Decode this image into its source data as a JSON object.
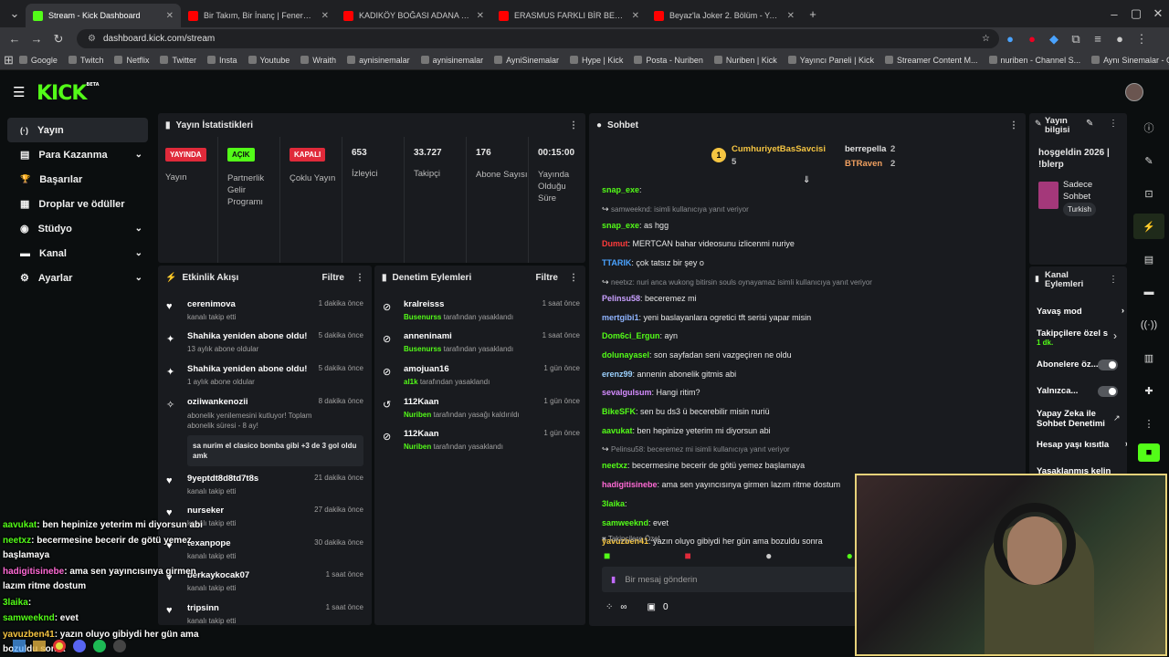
{
  "browser": {
    "tabs": [
      {
        "title": "Stream - Kick Dashboard",
        "fav": "#53fc18",
        "active": true
      },
      {
        "title": "Bir Takım, Bir İnanç | Fenerbahçe",
        "fav": "#ff0000"
      },
      {
        "title": "KADIKÖY BOĞASI ADANA YÜRÜ",
        "fav": "#ff0000"
      },
      {
        "title": "ERASMUS FARKLI BİR BEDENDE",
        "fav": "#ff0000"
      },
      {
        "title": "Beyaz'la Joker 2. Bölüm - YouTu",
        "fav": "#ff0000"
      }
    ],
    "url": "dashboard.kick.com/stream",
    "bookmarks": [
      "Google",
      "Twitch",
      "Netflix",
      "Twitter",
      "Insta",
      "Youtube",
      "Wraith",
      "aynisinemalar",
      "aynisinemalar",
      "AyniSinemalar",
      "Hype | Kick",
      "Posta - Nuriben",
      "Nuriben | Kick",
      "Yayıncı Paneli | Kick",
      "Streamer Content M...",
      "nuriben - Channel S...",
      "Aynı Sinemalar - Ça..."
    ]
  },
  "logo": "KICK",
  "logo_beta": "BETA",
  "sidebar": {
    "items": [
      {
        "icon": "(·)",
        "label": "Yayın",
        "chev": ""
      },
      {
        "icon": "▤",
        "label": "Para Kazanma",
        "chev": "⌄"
      },
      {
        "icon": "🏆",
        "label": "Başarılar",
        "chev": ""
      },
      {
        "icon": "▦",
        "label": "Droplar ve ödüller",
        "chev": ""
      },
      {
        "icon": "◉",
        "label": "Stüdyo",
        "chev": "⌄"
      },
      {
        "icon": "▬",
        "label": "Kanal",
        "chev": "⌄"
      },
      {
        "icon": "⚙",
        "label": "Ayarlar",
        "chev": "⌄"
      }
    ]
  },
  "stats": {
    "title": "Yayın İstatistikleri",
    "b1": "YAYINDA",
    "b1_label": "Yayın",
    "b2": "AÇIK",
    "b2_label": "Partnerlik Gelir Programı",
    "b3": "KAPALI",
    "b3_label": "Çoklu Yayın",
    "viewers": "653",
    "viewers_label": "İzleyici",
    "followers": "33.727",
    "followers_label": "Takipçi",
    "subs": "176",
    "subs_label": "Abone Sayısı",
    "duration": "00:15:00",
    "duration_label": "Yayında Olduğu Süre"
  },
  "activity": {
    "title": "Etkinlik Akışı",
    "filter": "Filtre",
    "items": [
      {
        "name": "cerenimova",
        "sub": "kanalı takip etti",
        "time": "1 dakika önce"
      },
      {
        "name": "Shahika yeniden abone oldu!",
        "sub": "13 aylık abone oldular",
        "time": "5 dakika önce"
      },
      {
        "name": "Shahika yeniden abone oldu!",
        "sub": "1 aylık abone oldular",
        "time": "5 dakika önce"
      },
      {
        "name": "oziiwankenozii",
        "sub": "abonelik yenilemesini kutluyor! Toplam abonelik süresi - 8 ay!",
        "time": "8 dakika önce",
        "msg": "sa nurim el clasico bomba gibi +3 de 3 gol oldu amk"
      },
      {
        "name": "9yeptdt8d8td7t8s",
        "sub": "kanalı takip etti",
        "time": "21 dakika önce"
      },
      {
        "name": "nurseker",
        "sub": "kanalı takip etti",
        "time": "27 dakika önce"
      },
      {
        "name": "texanpope",
        "sub": "kanalı takip etti",
        "time": "30 dakika önce"
      },
      {
        "name": "berkaykocak07",
        "sub": "kanalı takip etti",
        "time": "1 saat önce"
      },
      {
        "name": "tripsinn",
        "sub": "kanalı takip etti",
        "time": "1 saat önce"
      }
    ]
  },
  "mod": {
    "title": "Denetim Eylemleri",
    "filter": "Filtre",
    "items": [
      {
        "name": "kralreisss",
        "by": "Busenurss",
        "action": "tarafından yasaklandı",
        "time": "1 saat önce"
      },
      {
        "name": "anneninami",
        "by": "Busenurss",
        "action": "tarafından yasaklandı",
        "time": "1 saat önce"
      },
      {
        "name": "amojuan16",
        "by": "al1k",
        "action": "tarafından yasaklandı",
        "time": "1 gün önce"
      },
      {
        "name": "112Kaan",
        "by": "Nuriben",
        "action": "tarafından yasağı kaldırıldı",
        "time": "1 gün önce"
      },
      {
        "name": "112Kaan",
        "by": "Nuriben",
        "action": "tarafından yasaklandı",
        "time": "1 gün önce"
      }
    ]
  },
  "chat": {
    "title": "Sohbet",
    "top1": "CumhuriyetBasSavcisi",
    "top1_count": "5",
    "top1_rank": "1",
    "top2": "berrepella",
    "top2_count": "2",
    "top3": "BTRaven",
    "top3_count": "2",
    "lines": [
      {
        "user": "snap_exe",
        "color": "#53fc18",
        "text": ""
      },
      {
        "reply": "samweeknd: isimli kullanıcıya yanıt veriyor"
      },
      {
        "user": "snap_exe",
        "color": "#53fc18",
        "text": "as hgg"
      },
      {
        "user": "Dumut",
        "color": "#ff3b3b",
        "text": "MERTCAN bahar videosunu izlicenmi nuriye"
      },
      {
        "user": "TTARIK",
        "color": "#4aa3ff",
        "text": "çok tatsız bir şey o"
      },
      {
        "reply": "neetxz: nuri anca wukong bitirsin souls oynayamaz isimli kullanıcıya yanıt veriyor"
      },
      {
        "user": "Pelinsu58",
        "color": "#c9a0ff",
        "text": "beceremez mi"
      },
      {
        "user": "mertgibi1",
        "color": "#8fb4ff",
        "text": "yeni baslayanlara ogretici tft serisi yapar misin"
      },
      {
        "user": "Dom6ci_Ergun",
        "color": "#53fc18",
        "text": "ayn"
      },
      {
        "user": "dolunayasel",
        "color": "#53fc18",
        "text": "son sayfadan seni vazgeçiren ne oldu"
      },
      {
        "user": "erenz99",
        "color": "#9bd1ff",
        "text": "annenin abonelik gitmis abi"
      },
      {
        "user": "sevalgulsum",
        "color": "#d58cff",
        "text": "Hangi ritim?"
      },
      {
        "user": "BikeSFK",
        "color": "#53fc18",
        "text": "sen bu ds3 ü becerebilir misin nuriü"
      },
      {
        "user": "aavukat",
        "color": "#53fc18",
        "text": "ben hepinize yeterim mi diyorsun abi"
      },
      {
        "reply": "Pelinsu58: beceremez mi isimli kullanıcıya yanıt veriyor"
      },
      {
        "user": "neetxz",
        "color": "#53fc18",
        "text": "becermesine becerir de götü yemez başlamaya"
      },
      {
        "user": "hadigitisinebe",
        "color": "#ff6ad5",
        "text": "ama sen yayıncısınya girmen lazım ritme dostum"
      },
      {
        "user": "3laika",
        "color": "#53fc18",
        "text": ""
      },
      {
        "user": "samweeknd",
        "color": "#53fc18",
        "text": "evet"
      },
      {
        "user": "yavuzben41",
        "color": "#f5c542",
        "text": "yazın oluyo gibiydi her gün ama bozuldu sonra"
      }
    ],
    "followers_only": "Takipçilere Özel",
    "placeholder": "Bir mesaj gönderin",
    "infinity": "∞",
    "zero": "0"
  },
  "stream_info": {
    "title": "Yayın bilgisi",
    "text": "hoşgeldin 2026 | !blerp",
    "category": "Sadece Sohbet",
    "lang": "Turkish"
  },
  "channel_actions": {
    "title": "Kanal Eylemleri",
    "slow": "Yavaş mod",
    "followers": "Takipçilere özel s",
    "followers_sub": "1 dk.",
    "subs": "Abonelere öz...",
    "emotes": "Yalnızca...",
    "ai": "Yapay Zeka ile Sohbet Denetimi",
    "age": "Hesap yaşı kısıtla",
    "banned": "Yasaklanmış kelin"
  },
  "overlay": [
    {
      "user": "aavukat",
      "color": "#53fc18",
      "text": ": ben hepinize yeterim mi diyorsun abi"
    },
    {
      "user": "neetxz",
      "color": "#53fc18",
      "text": ": becermesine becerir de götü yemez başlamaya"
    },
    {
      "user": "hadigitisinebe",
      "color": "#ff6ad5",
      "text": ": ama sen yayıncısınya girmen lazım ritme dostum"
    },
    {
      "user": "3laika",
      "color": "#53fc18",
      "text": ":"
    },
    {
      "user": "samweeknd",
      "color": "#53fc18",
      "text": ": evet"
    },
    {
      "user": "yavuzben41",
      "color": "#f5c542",
      "text": ": yazın oluyo gibiydi her gün ama bozuldu sonra"
    }
  ]
}
